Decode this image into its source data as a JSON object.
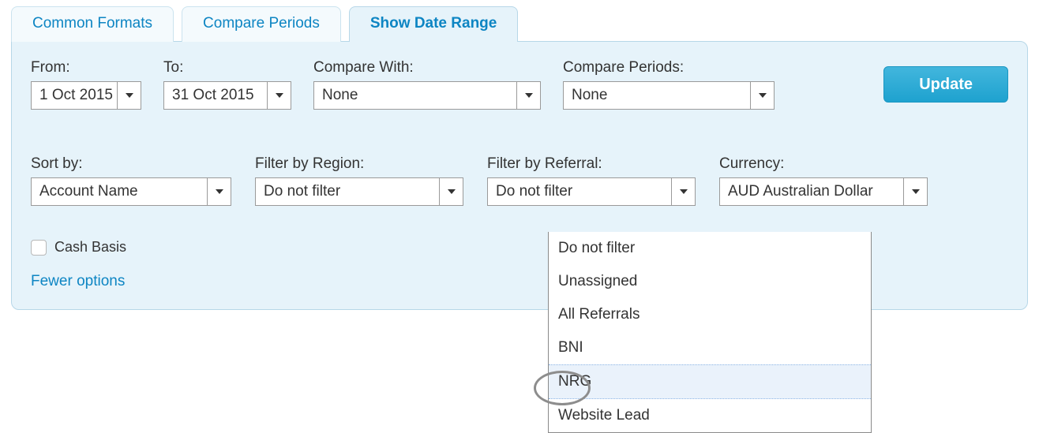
{
  "tabs": [
    {
      "label": "Common Formats",
      "active": false
    },
    {
      "label": "Compare Periods",
      "active": false
    },
    {
      "label": "Show Date Range",
      "active": true
    }
  ],
  "row1": {
    "from": {
      "label": "From:",
      "value": "1 Oct 2015"
    },
    "to": {
      "label": "To:",
      "value": "31 Oct 2015"
    },
    "compare": {
      "label": "Compare With:",
      "value": "None"
    },
    "periods": {
      "label": "Compare Periods:",
      "value": "None"
    },
    "update": "Update"
  },
  "row2": {
    "sort": {
      "label": "Sort by:",
      "value": "Account Name"
    },
    "region": {
      "label": "Filter by Region:",
      "value": "Do not filter"
    },
    "referral": {
      "label": "Filter by Referral:",
      "value": "Do not filter"
    },
    "currency": {
      "label": "Currency:",
      "value": "AUD Australian Dollar"
    }
  },
  "cashBasis": {
    "label": "Cash Basis",
    "checked": false
  },
  "fewerOptions": "Fewer options",
  "referralOptions": [
    "Do not filter",
    "Unassigned",
    "All Referrals",
    "BNI",
    "NRG",
    "Website Lead"
  ],
  "referralHighlightIndex": 4
}
